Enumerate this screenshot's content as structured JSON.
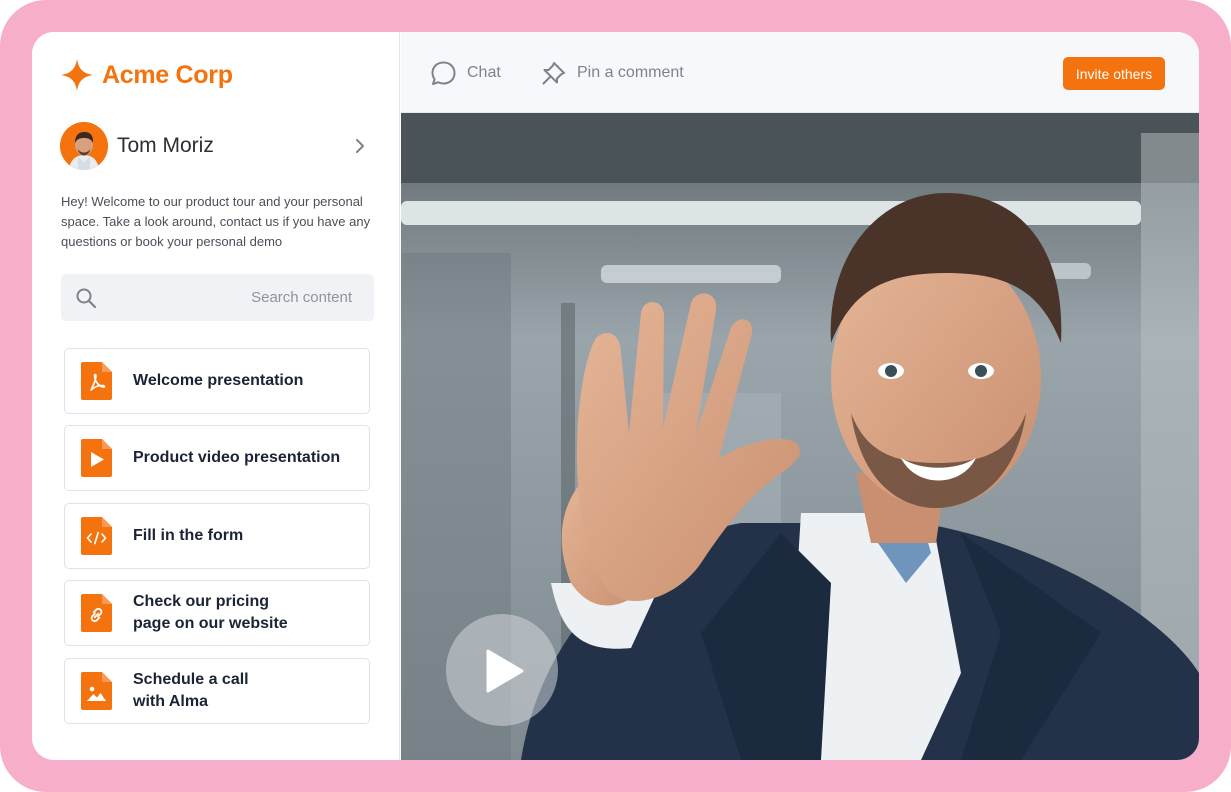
{
  "brand": {
    "name": "Acme Corp",
    "color": "#f4730f",
    "icon": "sparkle-icon"
  },
  "profile": {
    "name": "Tom Moriz",
    "avatar": "avatar-photo",
    "chevron": "chevron-right-icon"
  },
  "welcome_text": "Hey! Welcome to our product tour and your personal space. Take a look around, contact us if you have any questions or book your personal demo",
  "search": {
    "placeholder": "Search content",
    "value": "",
    "icon": "search-icon"
  },
  "content_items": [
    {
      "label": "Welcome presentation",
      "icon": "pdf-file-icon"
    },
    {
      "label": "Product video presentation",
      "icon": "video-file-icon"
    },
    {
      "label": "Fill in the form",
      "icon": "code-file-icon"
    },
    {
      "label": "Check our pricing\npage on our website",
      "icon": "link-file-icon"
    },
    {
      "label": "Schedule a call\nwith Alma",
      "icon": "image-file-icon"
    }
  ],
  "topbar": {
    "chat_label": "Chat",
    "chat_icon": "chat-bubble-icon",
    "pin_label": "Pin a comment",
    "pin_icon": "pin-icon",
    "invite_label": "Invite others"
  },
  "video": {
    "subject": "man-waving",
    "play_icon": "play-icon"
  },
  "colors": {
    "accent": "#f4730f",
    "frame": "#f7aecb",
    "text_dark": "#1b2435"
  }
}
